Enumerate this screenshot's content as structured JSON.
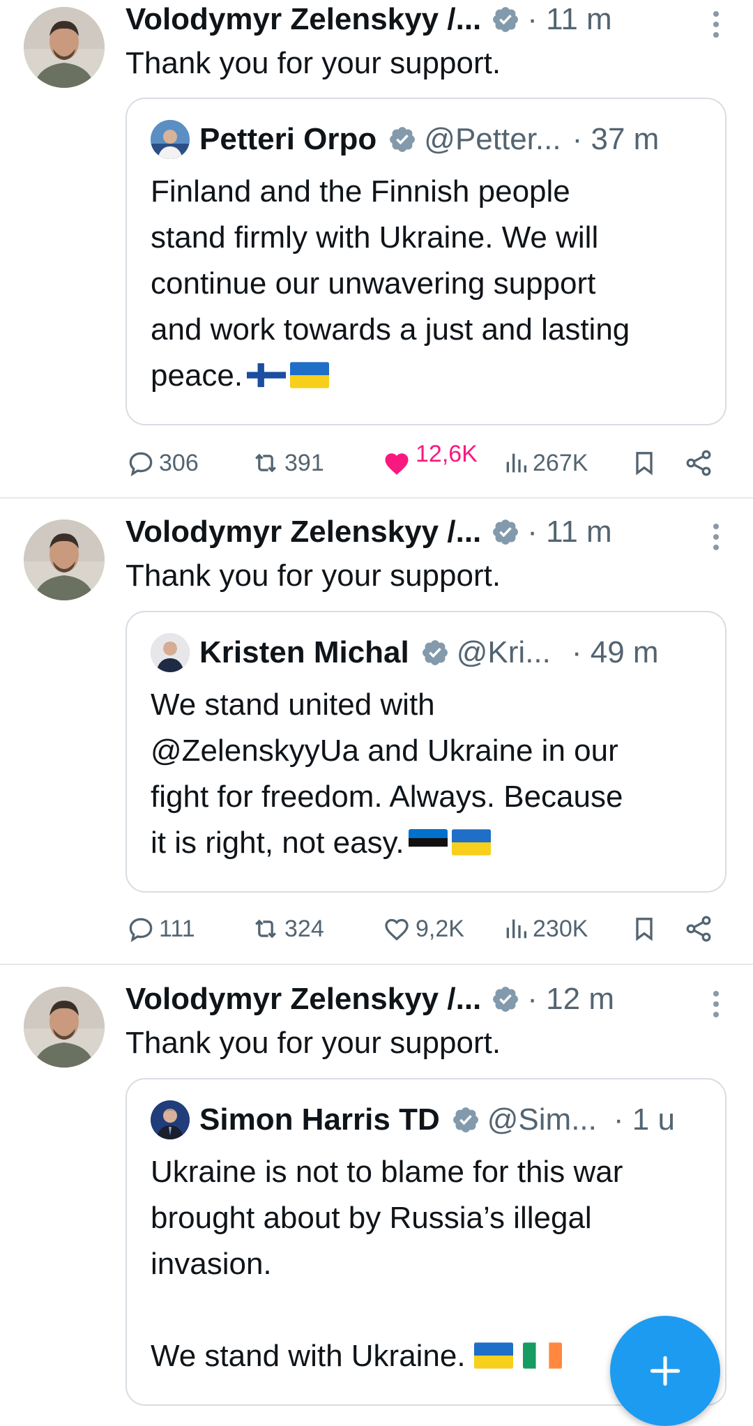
{
  "colors": {
    "accent": "#1d9bf0",
    "like": "#f91880",
    "muted": "#536471",
    "verified_badge": "#829aab"
  },
  "tweets": [
    {
      "author": "Volodymyr Zelenskyy /...",
      "time": "· 11 m",
      "text": "Thank you for your support.",
      "quote": {
        "author": "Petteri Orpo",
        "handle": "@Petter...",
        "time": "· 37 m",
        "lines": [
          "Finland and the Finnish people",
          "stand firmly with Ukraine. We will",
          "continue our unwavering support",
          "and work towards a just and lasting",
          "peace."
        ],
        "flags": [
          "finland-flag",
          "ukraine-flag"
        ]
      },
      "stats": {
        "replies": "306",
        "reposts": "391",
        "likes": "12,6K",
        "views": "267K",
        "liked": true
      }
    },
    {
      "author": "Volodymyr Zelenskyy /...",
      "time": "· 11 m",
      "text": "Thank you for your support.",
      "quote": {
        "author": "Kristen Michal",
        "handle": "@Kri...",
        "time": "· 49 m",
        "lines": [
          "We stand united with",
          "@ZelenskyyUa and Ukraine in our",
          "fight for freedom. Always. Because",
          "it is right, not easy."
        ],
        "flags": [
          "estonia-flag",
          "ukraine-flag"
        ]
      },
      "stats": {
        "replies": "111",
        "reposts": "324",
        "likes": "9,2K",
        "views": "230K",
        "liked": false
      }
    },
    {
      "author": "Volodymyr Zelenskyy /...",
      "time": "· 12 m",
      "text": "Thank you for your support.",
      "quote": {
        "author": "Simon Harris TD",
        "handle": "@Sim...",
        "time": "· 1 u",
        "lines": [
          "Ukraine is not to blame for this war",
          "brought about by Russia’s illegal",
          "invasion.",
          "",
          "We stand with Ukraine."
        ],
        "flags": [
          "ukraine-flag",
          "ireland-flag"
        ]
      }
    }
  ],
  "fab": {
    "icon": "plus-icon"
  }
}
